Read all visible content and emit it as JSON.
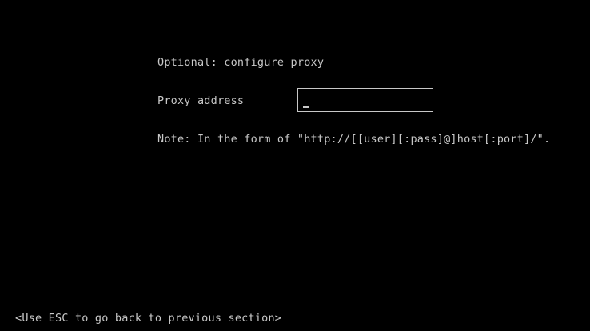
{
  "screen": {
    "heading": "Optional: configure proxy",
    "proxy": {
      "label": "Proxy address",
      "value": ""
    },
    "note": "Note: In the form of \"http://[[user][:pass]@]host[:port]/\".",
    "footer": "<Use ESC to go back to previous section>"
  },
  "colors": {
    "background": "#000000",
    "text": "#c8c8c8"
  }
}
